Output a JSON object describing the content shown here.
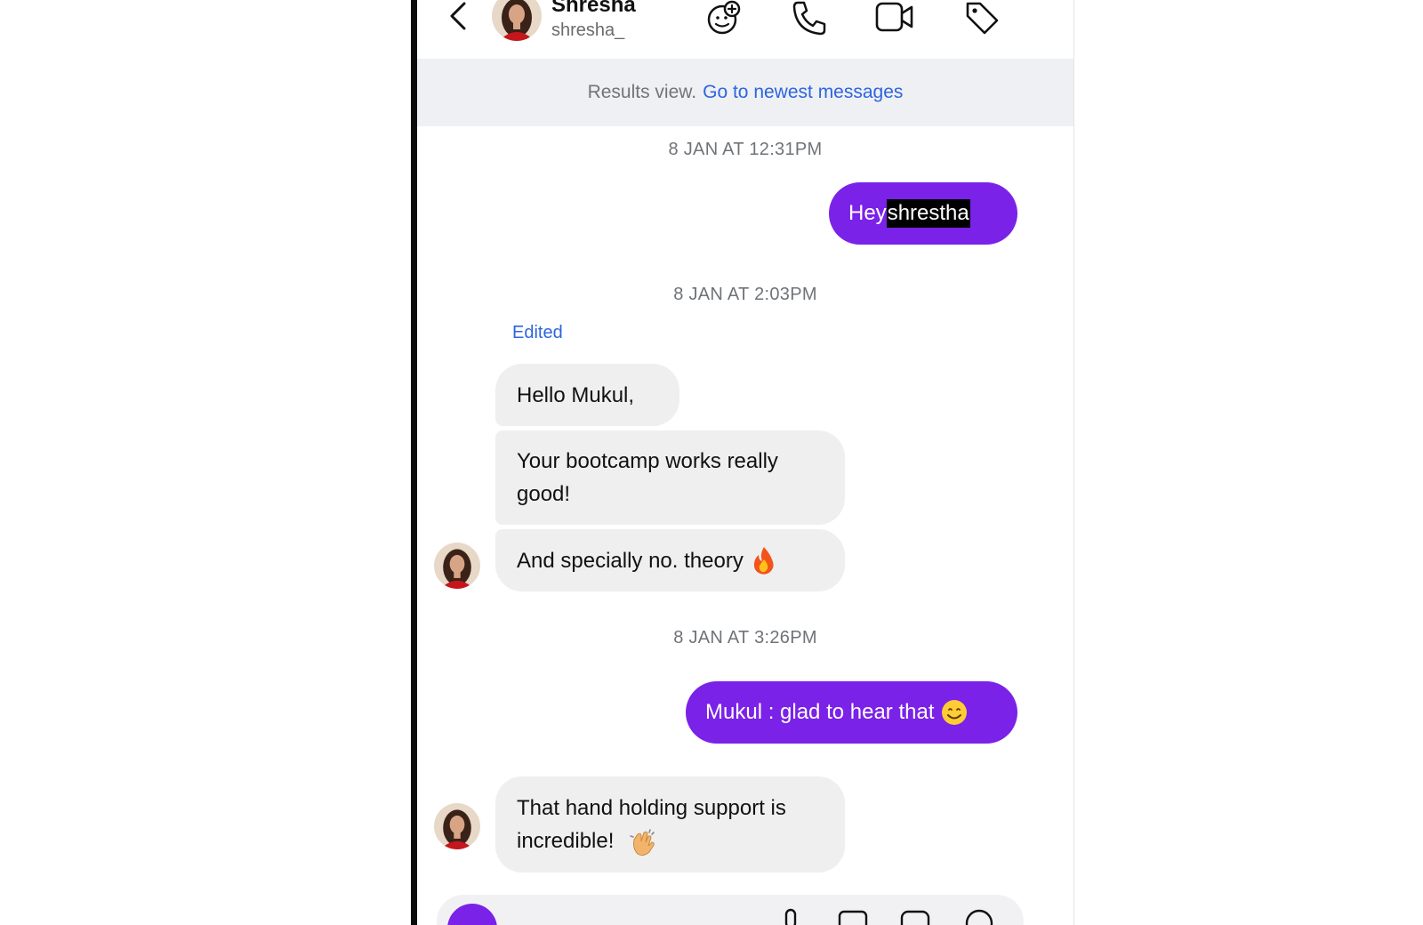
{
  "header": {
    "contact_name": "Shresha",
    "contact_handle": "shresha_",
    "icons": [
      "back-chevron-icon",
      "add-reaction-icon",
      "phone-icon",
      "video-camera-icon",
      "tag-icon"
    ]
  },
  "banner": {
    "label": "Results view.",
    "link": "Go to newest messages"
  },
  "messages": {
    "ts1": "8 JAN AT 12:31PM",
    "out1_prefix": "Hey ",
    "out1_highlight": "shrestha",
    "ts2": "8 JAN AT 2:03PM",
    "edited": "Edited",
    "in1": "Hello Mukul,",
    "in2": "Your bootcamp works really good!",
    "in3": "And specially no. theory",
    "ts3": "8 JAN AT 3:26PM",
    "out2": "Mukul : glad to hear that",
    "in4": "That hand holding support is incredible!"
  },
  "colors": {
    "accent": "#7a22e8",
    "link": "#2d64e0",
    "incoming_bubble": "#efefef",
    "banner_bg": "#eef0f3"
  }
}
